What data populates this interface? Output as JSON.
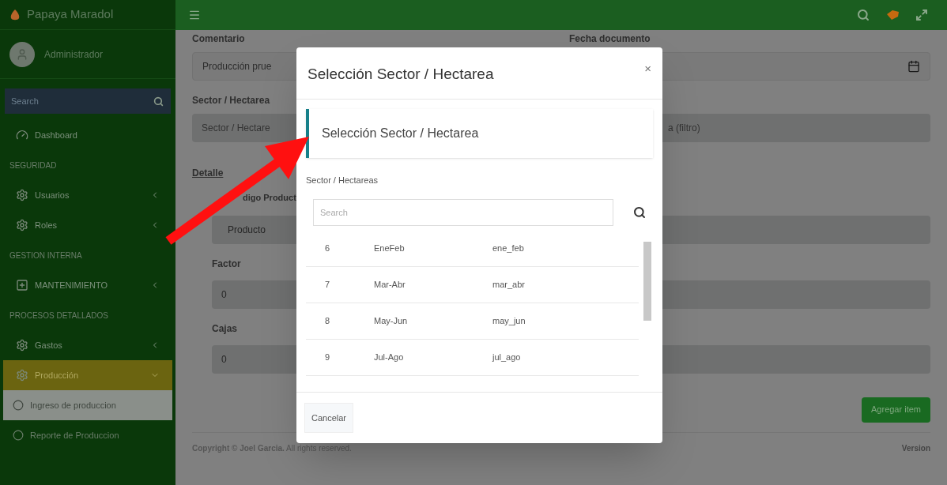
{
  "sidebar": {
    "brand": "Papaya Maradol",
    "user": "Administrador",
    "search": {
      "placeholder": "Search"
    },
    "items": [
      {
        "kind": "link",
        "label": "Dashboard",
        "selected": false
      },
      {
        "kind": "header",
        "label": "SEGURIDAD"
      },
      {
        "kind": "link",
        "label": "Usuarios",
        "expanded": false,
        "selected": false
      },
      {
        "kind": "link",
        "label": "Roles",
        "expanded": false,
        "selected": false
      },
      {
        "kind": "header",
        "label": "GESTION INTERNA"
      },
      {
        "kind": "link",
        "label": "MANTENIMIENTO",
        "expanded": false,
        "selected": false
      },
      {
        "kind": "header",
        "label": "PROCESOS DETALLADOS"
      },
      {
        "kind": "link",
        "label": "Gastos",
        "expanded": false,
        "selected": false
      },
      {
        "kind": "link",
        "label": "Producción",
        "expanded": true,
        "selected": true
      },
      {
        "kind": "sublink",
        "label": "Ingreso de produccion",
        "selected": true
      },
      {
        "kind": "sublink",
        "label": "Reporte de Produccion",
        "selected": false
      }
    ]
  },
  "form": {
    "comentario_label": "Comentario",
    "comentario_value": "Producción prue",
    "fecha_label": "Fecha documento",
    "sector_label": "Sector / Hectarea",
    "sector_placeholder": "Sector / Hectare",
    "sector_placeholder_tail": "a (filtro)",
    "detalle_label": "Detalle",
    "codigo_label": "digo Product",
    "codigo_placeholder": "Producto",
    "factor_label": "Factor",
    "factor_value": "0",
    "cajas_label": "Cajas",
    "cajas_value": "0",
    "add_button": "Agregar item"
  },
  "footer": {
    "copyright_owner": "Copyright © Joel Garcia.",
    "copyright_rest": "All rights reserved.",
    "version": "Version"
  },
  "modal": {
    "title": "Selección Sector / Hectarea",
    "close": "×",
    "callout": "Selección Sector / Hectarea",
    "list_label": "Sector / Hectareas",
    "search": {
      "placeholder": "Search"
    },
    "rows": [
      [
        "6",
        "EneFeb",
        "ene_feb"
      ],
      [
        "7",
        "Mar-Abr",
        "mar_abr"
      ],
      [
        "8",
        "May-Jun",
        "may_jun"
      ],
      [
        "9",
        "Jul-Ago",
        "jul_ago"
      ]
    ],
    "cancel": "Cancelar"
  }
}
